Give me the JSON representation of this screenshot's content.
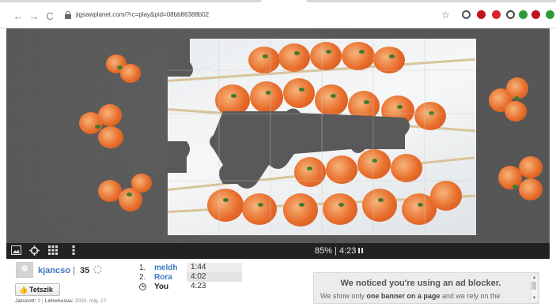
{
  "browser": {
    "url": "jigsawplanet.com/?rc=play&pid=08bb86388b02",
    "back_icon": "←",
    "forward_icon": "→",
    "reload_icon": "C",
    "star_icon": "☆",
    "extension_colors": [
      "#555555",
      "#c0141a",
      "#d8232a",
      "#444444",
      "#2e9b3a",
      "#c0141a",
      "#2e9b3a"
    ]
  },
  "toolbar": {
    "progress_text": "85% | 4:23",
    "icons": [
      "image-icon",
      "crosshair-icon",
      "grid-icon",
      "more-icon"
    ]
  },
  "user": {
    "name": "kjancso",
    "separator": "|",
    "score": "35"
  },
  "like_button": {
    "label": "Tetszik",
    "icon": "👍"
  },
  "meta": {
    "played_label": "Játszott:",
    "played_value": "3",
    "created_label": "Létrehozva:",
    "created_value": "2020. máj. 17."
  },
  "leaderboard": [
    {
      "rank": "1.",
      "name": "meldh",
      "time": "1:44",
      "name_color": "#3a78c2"
    },
    {
      "rank": "2.",
      "name": "Rora",
      "time": "4:02",
      "name_color": "#3a78c2"
    },
    {
      "rank": "",
      "name": "You",
      "time": "4:23",
      "name_color": "#222222"
    }
  ],
  "notice": {
    "title": "We noticed you're using an ad blocker.",
    "body_pre": "We show only ",
    "body_bold": "one banner on a page",
    "body_post": " and we rely on the",
    "scroll_up": "▲",
    "scroll_down": "▼"
  }
}
